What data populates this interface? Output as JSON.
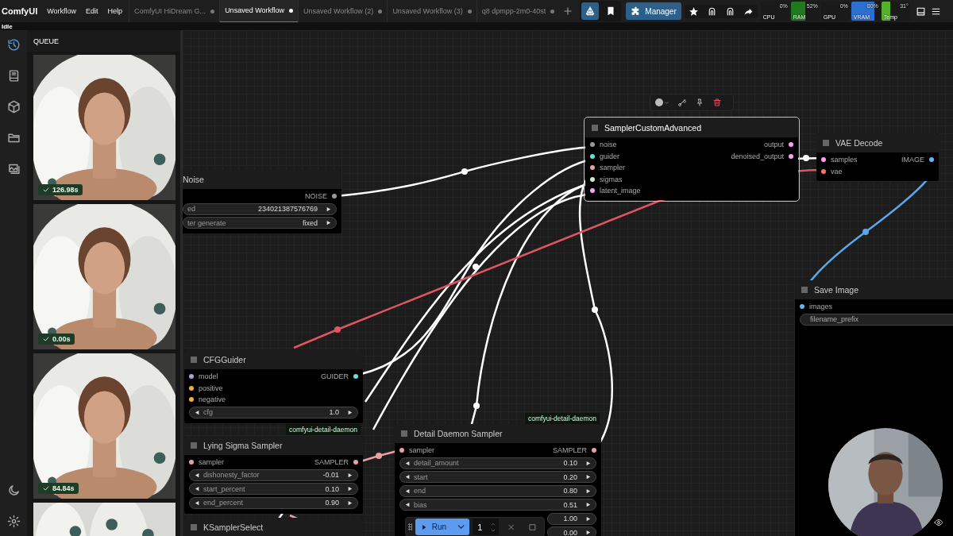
{
  "app": {
    "name": "ComfyUI",
    "status": "Idle"
  },
  "menu": [
    "Workflow",
    "Edit",
    "Help"
  ],
  "tabs": [
    {
      "label": "ComfyUI HiDream G...",
      "selected": false,
      "modified": true
    },
    {
      "label": "Unsaved Workflow",
      "selected": true,
      "modified": true
    },
    {
      "label": "Unsaved Workflow (2)",
      "selected": false,
      "modified": true
    },
    {
      "label": "Unsaved Workflow (3)",
      "selected": false,
      "modified": true
    },
    {
      "label": "q8 dpmpp-2m0-40st",
      "selected": false,
      "modified": true
    }
  ],
  "toolbar": {
    "toggles": [
      {
        "kind": "boat",
        "selected": true
      },
      {
        "kind": "bookmark",
        "selected": false
      }
    ],
    "manager": "Manager",
    "actions": [
      {
        "kind": "star"
      },
      {
        "kind": "arch"
      },
      {
        "kind": "arch"
      },
      {
        "kind": "share"
      }
    ]
  },
  "monitors": [
    {
      "label": "CPU",
      "reading": "0%"
    },
    {
      "label": "RAM",
      "reading": "52%",
      "level": 0.52,
      "color": "#1f7a1f"
    },
    {
      "label": "GPU",
      "reading": "0%"
    },
    {
      "label": "VRAM",
      "reading": "80%",
      "level": 0.8,
      "color": "#2c6fd1"
    },
    {
      "label": "Temp",
      "reading": "31°",
      "level": 0.31,
      "color": "#55b02a"
    }
  ],
  "sidebar": {
    "items": [
      {
        "kind": "history",
        "selected": true
      },
      {
        "kind": "library",
        "selected": false
      },
      {
        "kind": "models",
        "selected": false
      },
      {
        "kind": "workflows",
        "selected": false
      },
      {
        "kind": "gallery",
        "selected": false
      }
    ],
    "bottom": [
      {
        "kind": "theme"
      },
      {
        "kind": "settings"
      }
    ]
  },
  "queue": {
    "title": "QUEUE",
    "items": [
      {
        "kind": "picture",
        "time": "126.98s"
      },
      {
        "kind": "picture",
        "time": "0.00s"
      },
      {
        "kind": "picture",
        "time": "84.84s"
      },
      {
        "kind": "picture"
      }
    ]
  },
  "nodes": [
    {
      "title": "Noise",
      "selected": false,
      "outputs": [
        {
          "name": "NOISE",
          "color": "#9a9a9a"
        }
      ],
      "widgets": [
        {
          "name": "ed",
          "value": "234021387576769"
        },
        {
          "name": "ter generate",
          "value": "fixed"
        }
      ]
    },
    {
      "title": "SamplerCustomAdvanced",
      "selected": true,
      "inputs": [
        {
          "name": "noise",
          "color": "#9a9a9a"
        },
        {
          "name": "guider",
          "color": "#66dddd"
        },
        {
          "name": "sampler",
          "color": "#e8a0a0"
        },
        {
          "name": "sigmas",
          "color": "#cdeccd"
        },
        {
          "name": "latent_image",
          "color": "#ff9cf9"
        }
      ],
      "outputs": [
        {
          "name": "output",
          "color": "#ff9cf9"
        },
        {
          "name": "denoised_output",
          "color": "#ff9cf9"
        }
      ]
    },
    {
      "title": "VAE Decode",
      "selected": false,
      "inputs": [
        {
          "name": "samples",
          "color": "#ff9cf9"
        },
        {
          "name": "vae",
          "color": "#ff6e6e"
        }
      ],
      "outputs": [
        {
          "name": "IMAGE",
          "color": "#64b5f6"
        }
      ]
    },
    {
      "title": "CFGGuider",
      "selected": false,
      "inputs": [
        {
          "name": "model",
          "color": "#b39ddb"
        },
        {
          "name": "positive",
          "color": "#ffa931"
        },
        {
          "name": "negative",
          "color": "#ffa931"
        }
      ],
      "outputs": [
        {
          "name": "GUIDER",
          "color": "#66dddd"
        }
      ],
      "widgets": [
        {
          "name": "cfg",
          "value": "1.0"
        }
      ]
    },
    {
      "title": "Lying Sigma Sampler",
      "selected": false,
      "inputs": [
        {
          "name": "sampler",
          "color": "#e8a0a0"
        }
      ],
      "outputs": [
        {
          "name": "SAMPLER",
          "color": "#e8a0a0"
        }
      ],
      "widgets": [
        {
          "name": "dishonesty_factor",
          "value": "-0.01"
        },
        {
          "name": "start_percent",
          "value": "0.10"
        },
        {
          "name": "end_percent",
          "value": "0.90"
        }
      ]
    },
    {
      "title": "Detail Daemon Sampler",
      "selected": false,
      "inputs": [
        {
          "name": "sampler",
          "color": "#e8a0a0"
        }
      ],
      "outputs": [
        {
          "name": "SAMPLER",
          "color": "#e8a0a0"
        }
      ],
      "widgets": [
        {
          "name": "detail_amount",
          "value": "0.10"
        },
        {
          "name": "start",
          "value": "0.20"
        },
        {
          "name": "end",
          "value": "0.80"
        },
        {
          "name": "bias",
          "value": "0.51"
        },
        {
          "value": "1.00"
        },
        {
          "value": "0.00"
        }
      ]
    },
    {
      "title": "Save Image",
      "selected": false,
      "inputs": [
        {
          "name": "images",
          "color": "#64b5f6"
        }
      ],
      "widgets": [
        {
          "kind": "text",
          "name": "filename_prefix"
        }
      ]
    },
    {
      "title": "KSamplerSelect",
      "selected": false
    }
  ],
  "badges": [
    "comfyui-detail-daemon",
    "comfyui-detail-daemon"
  ],
  "run_bar": {
    "label": "Run",
    "count": "1"
  }
}
